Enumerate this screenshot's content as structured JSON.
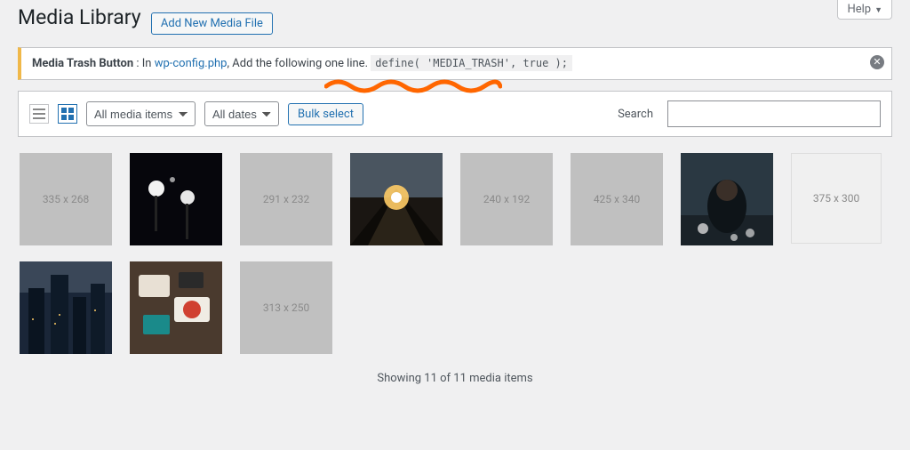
{
  "help": {
    "label": "Help"
  },
  "header": {
    "title": "Media Library",
    "add_new": "Add New Media File"
  },
  "notice": {
    "strong": "Media Trash Button",
    "pre_link": " : In ",
    "link": "wp-config.php",
    "mid": ", Add the following one line. ",
    "code": "define( 'MEDIA_TRASH', true );"
  },
  "toolbar": {
    "media_filter": "All media items",
    "date_filter": "All dates",
    "bulk_select": "Bulk select",
    "search_label": "Search"
  },
  "tiles": [
    {
      "type": "placeholder",
      "label": "335 x 268"
    },
    {
      "type": "image",
      "bg": "#0a0a12",
      "svg": "lights"
    },
    {
      "type": "placeholder",
      "label": "291 x 232"
    },
    {
      "type": "image",
      "bg": "#2b2620",
      "svg": "perspective"
    },
    {
      "type": "placeholder",
      "label": "240 x 192"
    },
    {
      "type": "placeholder",
      "label": "425 x 340"
    },
    {
      "type": "image",
      "bg": "#1a2228",
      "svg": "hoodie"
    },
    {
      "type": "placeholder-light",
      "label": "375 x 300"
    },
    {
      "type": "image",
      "bg": "#1e2a38",
      "svg": "city"
    },
    {
      "type": "image",
      "bg": "#3a2f28",
      "svg": "desk"
    },
    {
      "type": "placeholder",
      "label": "313 x 250"
    }
  ],
  "footer": {
    "count_text": "Showing 11 of 11 media items"
  }
}
